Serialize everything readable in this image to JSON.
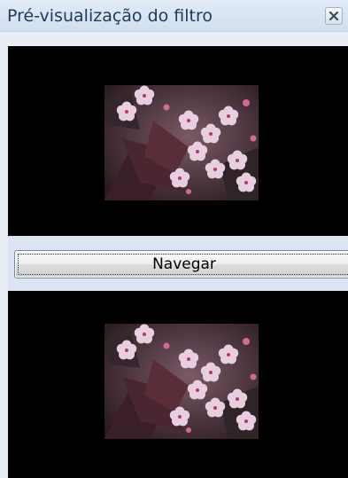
{
  "window": {
    "title": "Pré-visualização do filtro",
    "close_icon": "close-icon"
  },
  "previews": {
    "top_image": "flower-photo",
    "bottom_image": "flower-photo"
  },
  "browse_button": {
    "label": "Navegar"
  },
  "colors": {
    "title_text": "#1e395b",
    "preview_background": "#000000",
    "button_focus_border": "#6f8ab2"
  }
}
